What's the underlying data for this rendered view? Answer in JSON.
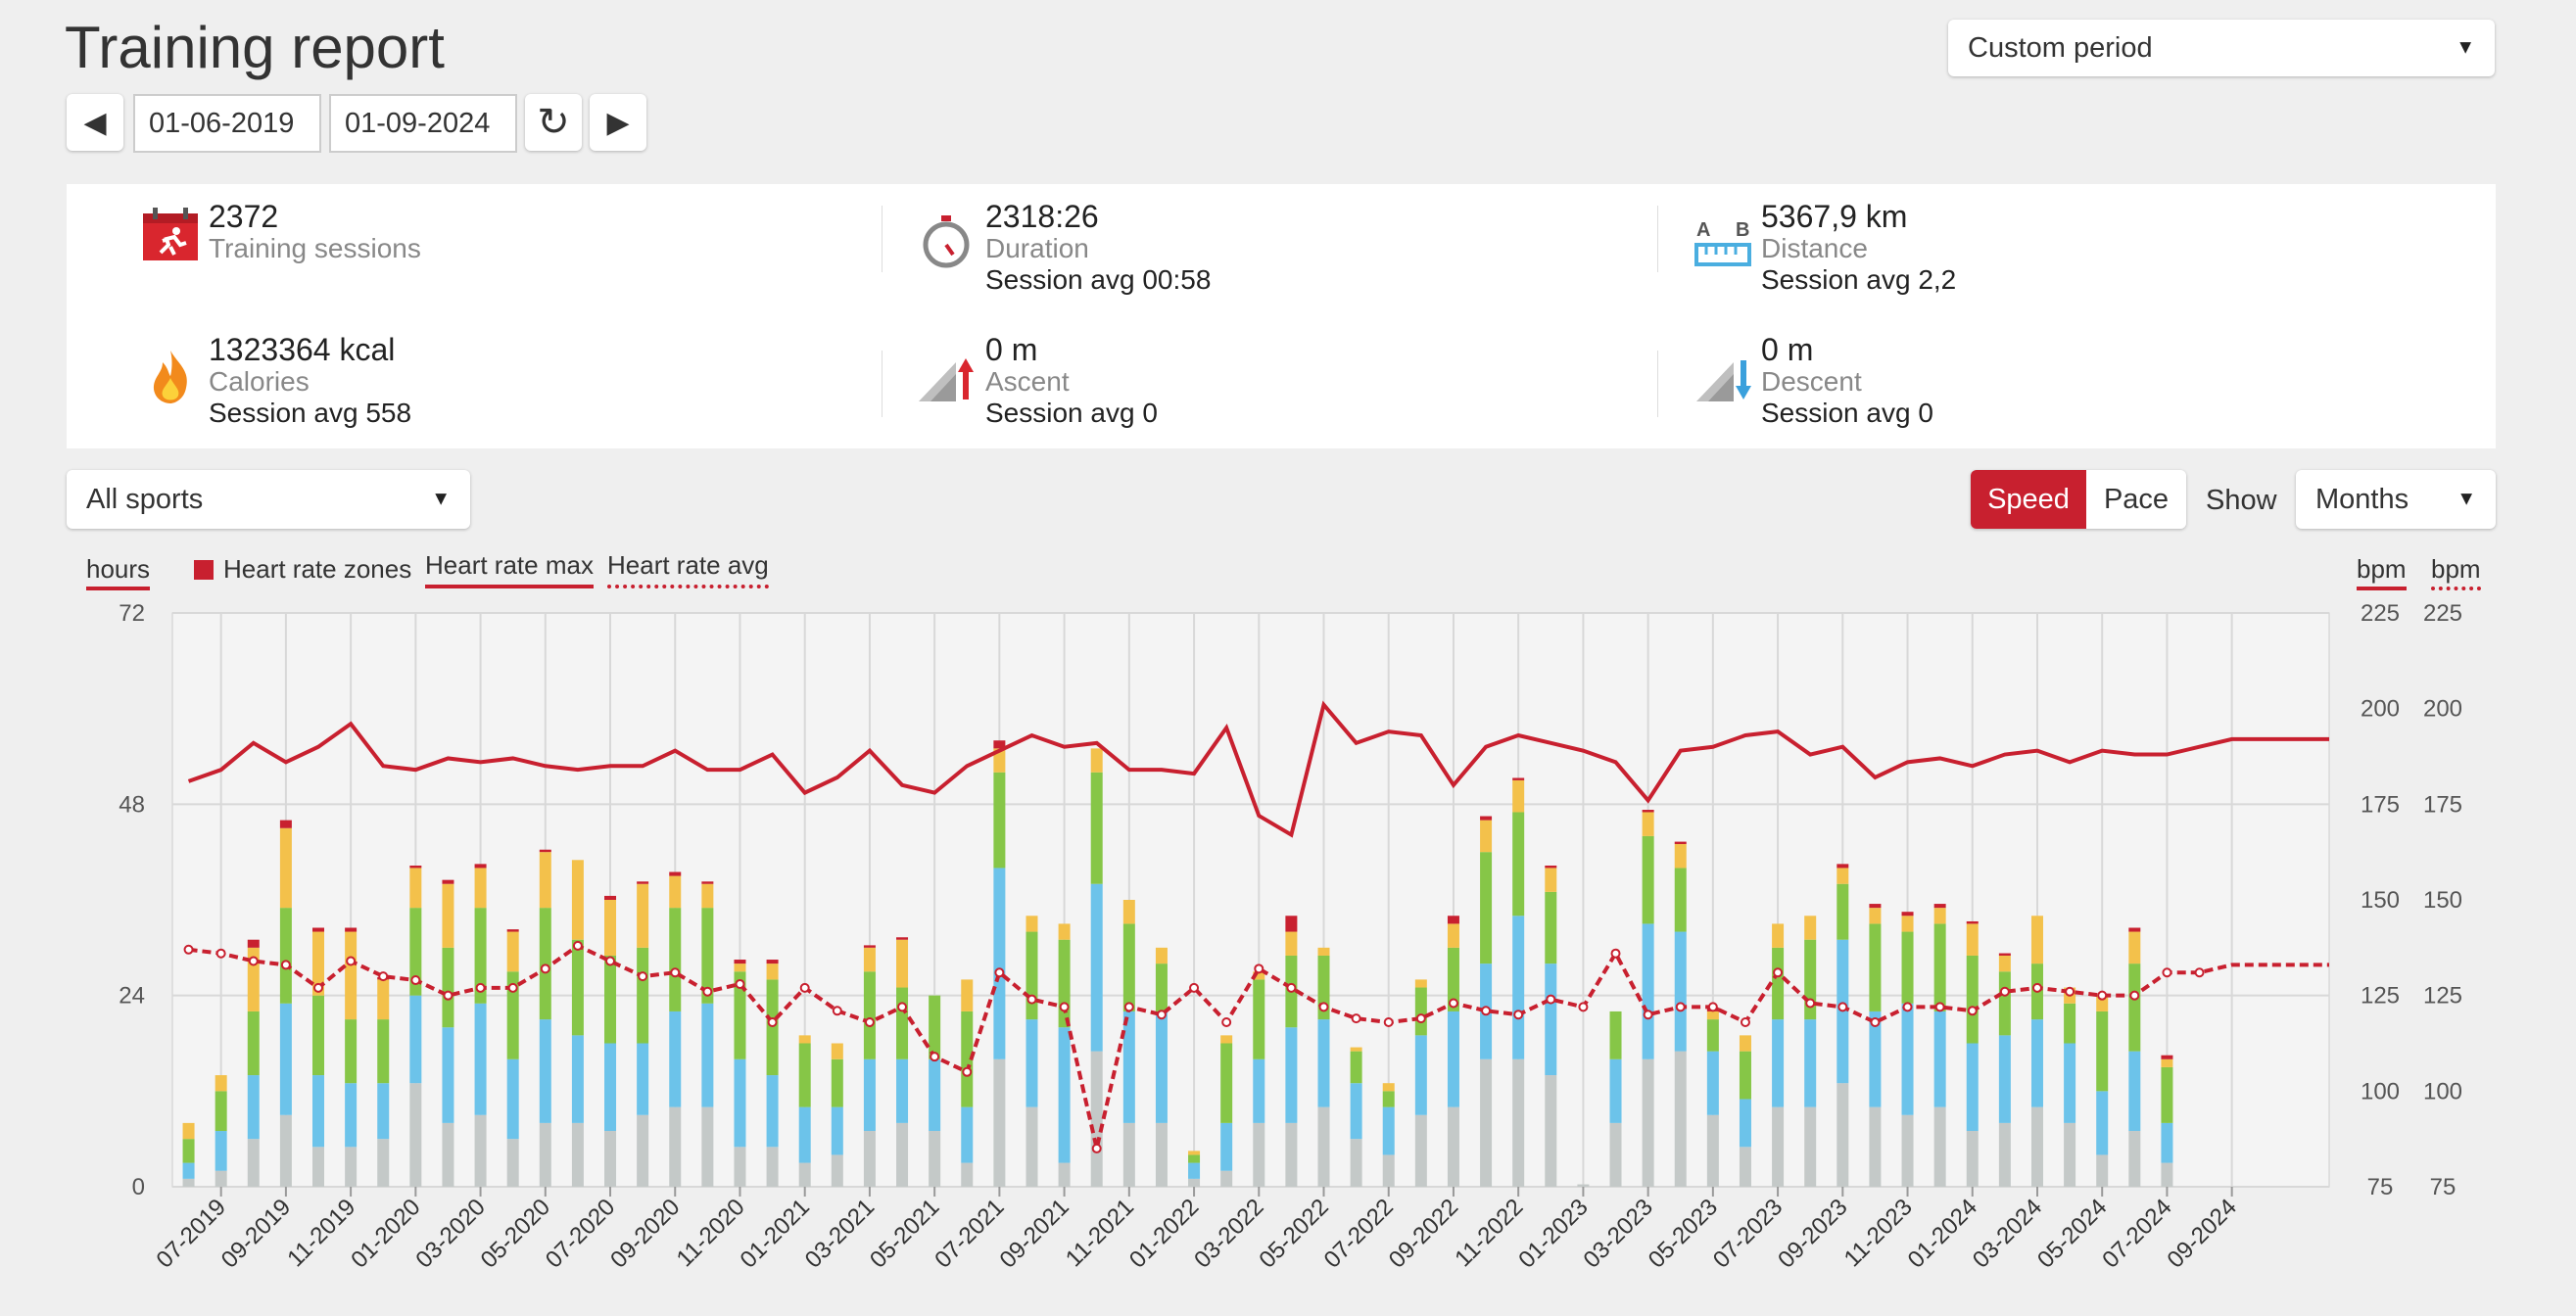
{
  "header": {
    "title": "Training report",
    "period_select": "Custom period"
  },
  "nav": {
    "prev_label": "◀",
    "next_label": "▶",
    "start_date": "01-06-2019",
    "end_date": "01-09-2024",
    "refresh_label": "↻"
  },
  "summary": {
    "sessions": {
      "value": "2372",
      "label": "Training sessions"
    },
    "duration": {
      "value": "2318:26",
      "label": "Duration",
      "sub": "Session avg 00:58"
    },
    "distance": {
      "value": "5367,9 km",
      "label": "Distance",
      "sub": "Session avg 2,2",
      "icon_a": "A",
      "icon_b": "B"
    },
    "calories": {
      "value": "1323364 kcal",
      "label": "Calories",
      "sub": "Session avg 558"
    },
    "ascent": {
      "value": "0 m",
      "label": "Ascent",
      "sub": "Session avg 0"
    },
    "descent": {
      "value": "0 m",
      "label": "Descent",
      "sub": "Session avg 0"
    }
  },
  "controls": {
    "sport_select": "All sports",
    "speed_label": "Speed",
    "pace_label": "Pace",
    "show_label": "Show",
    "period_unit": "Months"
  },
  "legend": {
    "hours": "hours",
    "zones": "Heart rate zones",
    "hr_max": "Heart rate max",
    "hr_avg": "Heart rate avg",
    "bpm1": "bpm",
    "bpm2": "bpm"
  },
  "colors": {
    "accent": "#c8202f",
    "zone_grey": "#c4c9c8",
    "zone_blue": "#6cc3ea",
    "zone_green": "#86c647",
    "zone_yellow": "#f3c14b",
    "zone_red": "#c8202f"
  },
  "chart_data": {
    "type": "bar",
    "left_axis": {
      "label": "hours",
      "ticks": [
        0,
        24,
        48,
        72
      ],
      "ylim": [
        0,
        72
      ]
    },
    "right_axis": {
      "label": "bpm",
      "ticks": [
        75,
        100,
        125,
        150,
        175,
        200,
        225
      ],
      "ylim": [
        75,
        225
      ]
    },
    "x_tick_labels": [
      "07-2019",
      "09-2019",
      "11-2019",
      "01-2020",
      "03-2020",
      "05-2020",
      "07-2020",
      "09-2020",
      "11-2020",
      "01-2021",
      "03-2021",
      "05-2021",
      "07-2021",
      "09-2021",
      "11-2021",
      "01-2022",
      "03-2022",
      "05-2022",
      "07-2022",
      "09-2022",
      "11-2022",
      "01-2023",
      "03-2023",
      "05-2023",
      "07-2023",
      "09-2023",
      "11-2023",
      "01-2024",
      "03-2024",
      "05-2024",
      "07-2024",
      "09-2024"
    ],
    "series_names": [
      "Heart rate zones",
      "Heart rate max",
      "Heart rate avg"
    ],
    "zone_stacks_hours": [
      [
        1,
        2,
        3,
        2,
        0
      ],
      [
        2,
        5,
        5,
        2,
        0
      ],
      [
        6,
        8,
        8,
        8,
        1
      ],
      [
        9,
        14,
        12,
        10,
        1
      ],
      [
        5,
        9,
        10,
        8,
        0.5
      ],
      [
        5,
        8,
        8,
        11,
        0.5
      ],
      [
        6,
        7,
        8,
        5,
        0.3
      ],
      [
        13,
        11,
        11,
        5,
        0.3
      ],
      [
        8,
        12,
        10,
        8,
        0.5
      ],
      [
        9,
        14,
        12,
        5,
        0.5
      ],
      [
        6,
        10,
        11,
        5,
        0.3
      ],
      [
        8,
        13,
        14,
        7,
        0.3
      ],
      [
        8,
        11,
        12,
        10,
        0
      ],
      [
        7,
        11,
        11,
        7,
        0.5
      ],
      [
        9,
        9,
        12,
        8,
        0.3
      ],
      [
        10,
        12,
        13,
        4,
        0.5
      ],
      [
        10,
        13,
        12,
        3,
        0.3
      ],
      [
        5,
        11,
        11,
        1,
        0.5
      ],
      [
        5,
        9,
        12,
        2,
        0.5
      ],
      [
        3,
        7,
        8,
        1,
        0
      ],
      [
        4,
        6,
        6,
        2,
        0
      ],
      [
        7,
        9,
        11,
        3,
        0.3
      ],
      [
        8,
        8,
        9,
        6,
        0.3
      ],
      [
        7,
        9,
        8,
        0,
        0
      ],
      [
        3,
        7,
        12,
        4,
        0
      ],
      [
        16,
        24,
        12,
        3,
        1
      ],
      [
        10,
        11,
        11,
        2,
        0
      ],
      [
        3,
        17,
        11,
        2,
        0
      ],
      [
        17,
        21,
        14,
        3,
        0
      ],
      [
        8,
        14,
        11,
        3,
        0
      ],
      [
        8,
        14,
        6,
        2,
        0
      ],
      [
        1,
        2,
        1,
        0.5,
        0
      ],
      [
        2,
        6,
        10,
        1,
        0
      ],
      [
        8,
        8,
        10,
        1,
        0
      ],
      [
        8,
        12,
        9,
        3,
        2
      ],
      [
        10,
        11,
        8,
        1,
        0
      ],
      [
        6,
        7,
        4,
        0.5,
        0
      ],
      [
        4,
        6,
        2,
        1,
        0
      ],
      [
        9,
        10,
        6,
        1,
        0
      ],
      [
        10,
        12,
        8,
        3,
        1
      ],
      [
        16,
        12,
        14,
        4,
        0.5
      ],
      [
        16,
        18,
        13,
        4,
        0.3
      ],
      [
        14,
        14,
        9,
        3,
        0.3
      ],
      [
        0.3,
        0,
        0,
        0,
        0
      ],
      [
        8,
        8,
        6,
        0,
        0
      ],
      [
        16,
        17,
        11,
        3,
        0.3
      ],
      [
        17,
        15,
        8,
        3,
        0.3
      ],
      [
        9,
        8,
        4,
        1,
        0.5
      ],
      [
        5,
        6,
        6,
        2,
        0
      ],
      [
        10,
        11,
        9,
        3,
        0
      ],
      [
        10,
        11,
        10,
        3,
        0
      ],
      [
        13,
        18,
        7,
        2,
        0.5
      ],
      [
        10,
        12,
        11,
        2,
        0.5
      ],
      [
        9,
        14,
        9,
        2,
        0.5
      ],
      [
        10,
        12,
        11,
        2,
        0.5
      ],
      [
        7,
        11,
        11,
        4,
        0.3
      ],
      [
        8,
        11,
        8,
        2,
        0.3
      ],
      [
        10,
        11,
        7,
        6,
        0
      ],
      [
        8,
        10,
        5,
        2,
        0
      ],
      [
        4,
        8,
        10,
        2,
        0
      ],
      [
        7,
        10,
        11,
        4,
        0.5
      ],
      [
        3,
        5,
        7,
        1,
        0.5
      ]
    ],
    "hr_max_bpm": [
      181,
      184,
      191,
      186,
      190,
      196,
      185,
      184,
      187,
      186,
      187,
      185,
      184,
      185,
      185,
      189,
      184,
      184,
      188,
      178,
      182,
      189,
      180,
      178,
      185,
      189,
      193,
      190,
      191,
      184,
      184,
      183,
      195,
      172,
      167,
      201,
      191,
      194,
      193,
      180,
      190,
      193,
      191,
      189,
      186,
      176,
      189,
      190,
      193,
      194,
      188,
      190,
      182,
      186,
      187,
      185,
      188,
      189,
      186,
      189,
      188,
      188,
      190,
      192,
      192,
      192,
      192
    ],
    "hr_avg_bpm": [
      137,
      136,
      134,
      133,
      127,
      134,
      130,
      129,
      125,
      127,
      127,
      132,
      138,
      134,
      130,
      131,
      126,
      128,
      118,
      127,
      121,
      118,
      122,
      109,
      105,
      131,
      124,
      122,
      85,
      122,
      120,
      127,
      118,
      132,
      127,
      122,
      119,
      118,
      119,
      123,
      121,
      120,
      124,
      122,
      136,
      120,
      122,
      122,
      118,
      131,
      123,
      122,
      118,
      122,
      122,
      121,
      126,
      127,
      126,
      125,
      125,
      131,
      131,
      133,
      133,
      133,
      133
    ]
  }
}
